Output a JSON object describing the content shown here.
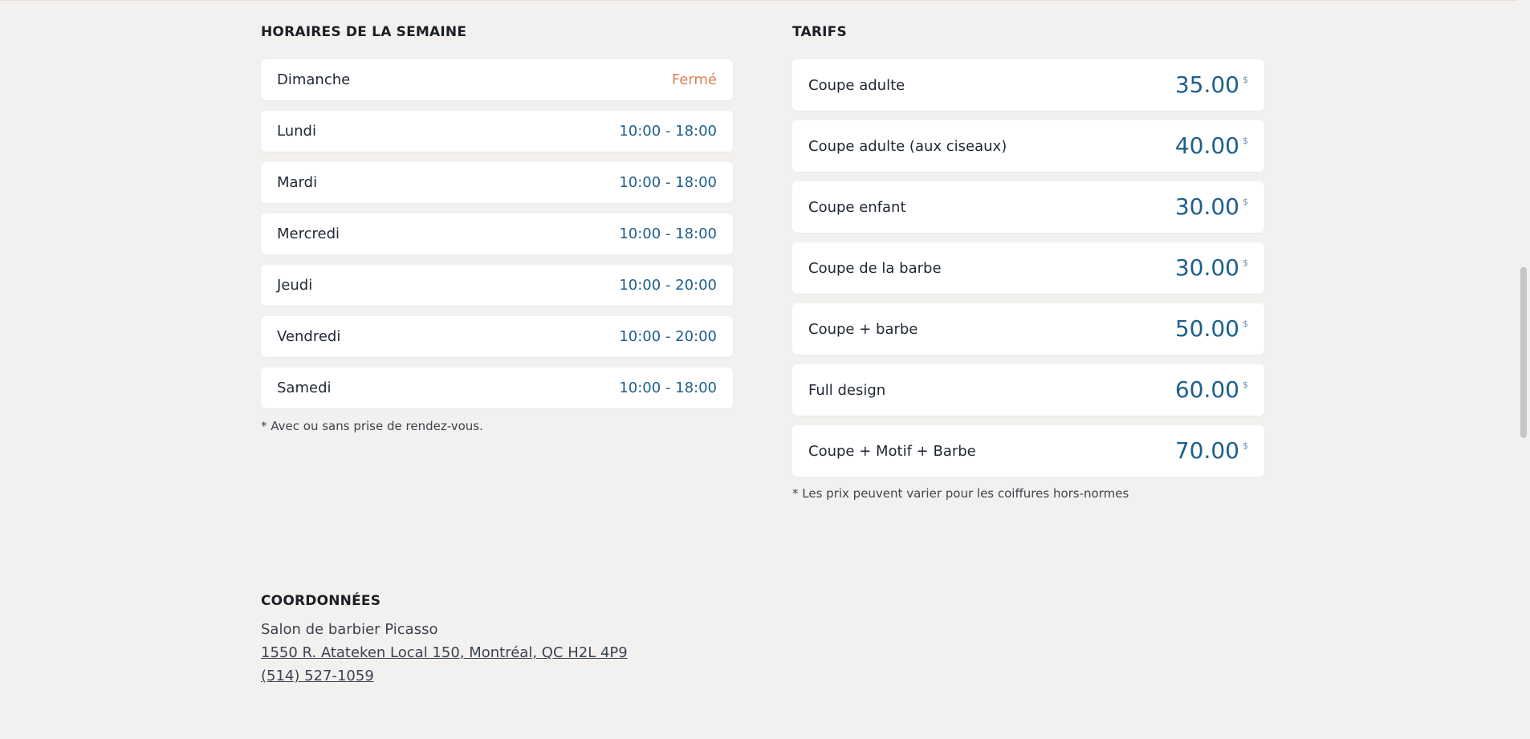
{
  "hours": {
    "title": "HORAIRES DE LA SEMAINE",
    "days": [
      {
        "day": "Dimanche",
        "value": "Fermé",
        "closed": true
      },
      {
        "day": "Lundi",
        "value": "10:00 - 18:00"
      },
      {
        "day": "Mardi",
        "value": "10:00 - 18:00"
      },
      {
        "day": "Mercredi",
        "value": "10:00 - 18:00"
      },
      {
        "day": "Jeudi",
        "value": "10:00 - 20:00"
      },
      {
        "day": "Vendredi",
        "value": "10:00 - 20:00"
      },
      {
        "day": "Samedi",
        "value": "10:00 - 18:00"
      }
    ],
    "note": "* Avec ou sans prise de rendez-vous."
  },
  "prices": {
    "title": "TARIFS",
    "currency": "$",
    "items": [
      {
        "service": "Coupe adulte",
        "price": "35.00"
      },
      {
        "service": "Coupe adulte (aux ciseaux)",
        "price": "40.00"
      },
      {
        "service": "Coupe enfant",
        "price": "30.00"
      },
      {
        "service": "Coupe de la barbe",
        "price": "30.00"
      },
      {
        "service": "Coupe + barbe",
        "price": "50.00"
      },
      {
        "service": "Full design",
        "price": "60.00"
      },
      {
        "service": "Coupe + Motif + Barbe",
        "price": "70.00"
      }
    ],
    "note": "* Les prix peuvent varier pour les coiffures hors-normes"
  },
  "contact": {
    "title": "COORDONNÉES",
    "name": "Salon de barbier Picasso",
    "address": "1550 R. Atateken Local 150, Montréal, QC H2L 4P9",
    "phone": "(514) 527-1059"
  },
  "colors": {
    "background": "#f3f1ef",
    "accent": "#1e5f8c",
    "closed": "#d9845b"
  }
}
